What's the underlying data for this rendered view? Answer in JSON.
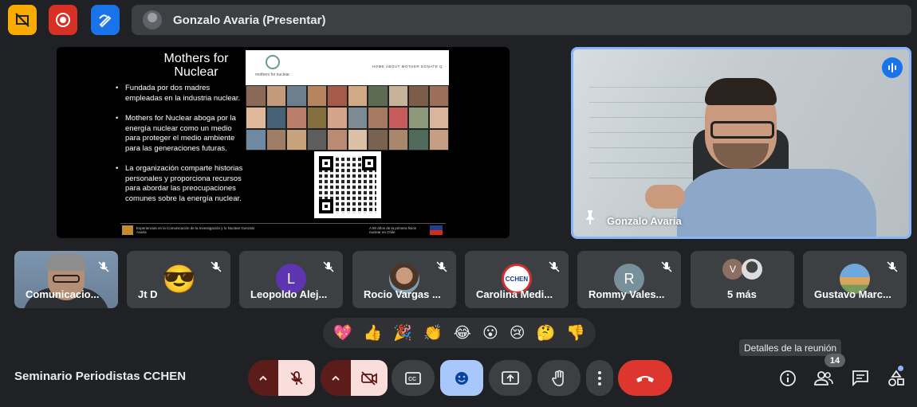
{
  "presenter_bar": {
    "text": "Gonzalo Avaria (Presentar)"
  },
  "slide": {
    "title_line1": "Mothers for",
    "title_line2": "Nuclear",
    "bullets": [
      "Fundada por dos madres empleadas en la industria nuclear.",
      "Mothers for Nuclear aboga por la energía nuclear como un medio para proteger el medio ambiente para las generaciones futuras.",
      "La organización comparte historias personales y proporciona recursos para abordar las preocupaciones comunes sobre la energía nuclear."
    ],
    "website_logo_text": "mothers for nuclear",
    "website_nav": "HOME   ABOUT   MOTHER   DONATE   Q",
    "footer_left": "Experiencias en la Comunicación de la Investigación y lo Nuclear Gonzalo Avaria",
    "footer_right": "A 50 años de la primera fisión nuclear en Chile"
  },
  "speaker": {
    "name": "Gonzalo Avaria"
  },
  "participants": [
    {
      "name": "Comunicacio..."
    },
    {
      "name": "Jt D",
      "avatar": "😎"
    },
    {
      "name": "Leopoldo Alej...",
      "initial": "L",
      "color": "#5e35b1"
    },
    {
      "name": "Rocio Vargas ..."
    },
    {
      "name": "Carolina Medi...",
      "avatar_text": "CCHEN"
    },
    {
      "name": "Rommy Vales...",
      "initial": "R",
      "color": "#78909c"
    },
    {
      "name": "5 más",
      "initial": "V",
      "color": "#8d6e63"
    },
    {
      "name": "Gustavo Marc..."
    }
  ],
  "reactions": [
    "💖",
    "👍",
    "🎉",
    "👏",
    "😂",
    "😮",
    "😢",
    "🤔",
    "👎"
  ],
  "tooltip": "Detalles de la reunión",
  "meeting_title": "Seminario Periodistas CCHEN",
  "people_count": "14",
  "colors": {
    "background": "#202124",
    "accent": "#8ab4f8",
    "end_call": "#dc362e",
    "highlight": "#a8c7fa"
  }
}
